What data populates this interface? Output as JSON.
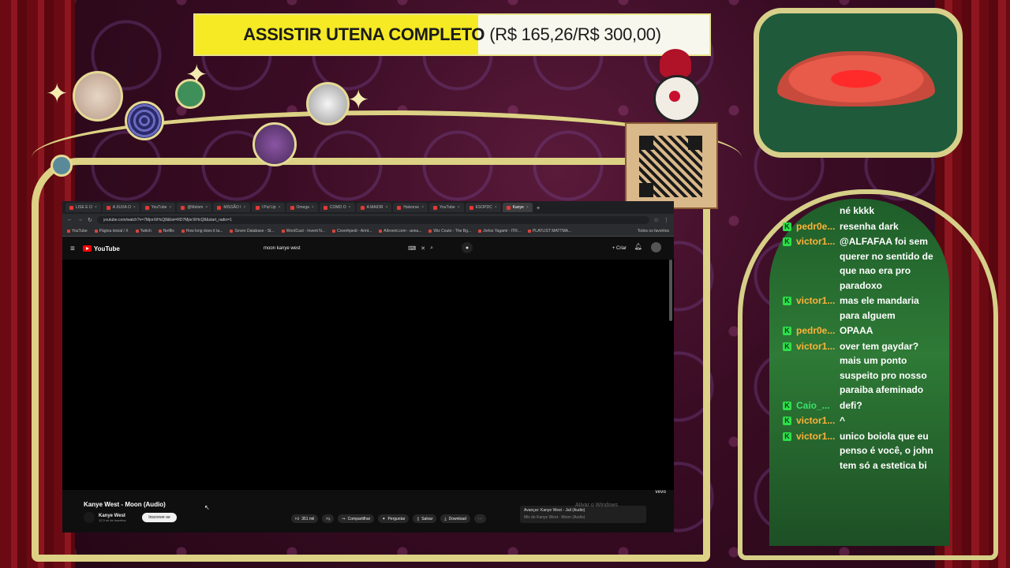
{
  "banner": {
    "label": "ASSISTIR UTENA COMPLETO",
    "value": "(R$ 165,26/R$ 300,00)",
    "progress": 0.551,
    "fill_color": "#f5ea24"
  },
  "browser": {
    "tabs": [
      {
        "label": "LISE E O"
      },
      {
        "label": "A XUXA O"
      },
      {
        "label": "YouTube"
      },
      {
        "label": "@Melom"
      },
      {
        "label": "MISSÃO I"
      },
      {
        "label": "I Put Up"
      },
      {
        "label": "Omega"
      },
      {
        "label": "COMO O"
      },
      {
        "label": "A MAIOR"
      },
      {
        "label": "Halvorse"
      },
      {
        "label": "YouTube"
      },
      {
        "label": "ESOPDC"
      },
      {
        "label": "Kanye"
      }
    ],
    "url": "youtube.com/watch?v=7MjorXiHcQ8&list=RD7MjorXiHcQ8&start_radio=1",
    "bookmarks": [
      "YouTube",
      "Página inicial / X",
      "Twitch",
      "Netflix",
      "How long does it ta...",
      "Seven Database - St...",
      "WordCast - Invent N...",
      "Coverhpedi - Arint...",
      "Allvvent.com - anna...",
      "Wiz Couto - The Bg...",
      "Jorlos Yagami - ITR...",
      "PLAYLIST MATTMA..."
    ],
    "bookmarks_right": "Todos os favoritos"
  },
  "youtube": {
    "logo": "YouTube",
    "search_query": "moon kanye west",
    "create_label": "Criar",
    "video_title": "Kanye West - Moon (Audio)",
    "channel_name": "Kanye West",
    "subscribers": "12,3 mi de inscritos",
    "subscribe_label": "Inscrever-se",
    "likes": "351 mil",
    "share_label": "Compartilhar",
    "ask_label": "Perguntar",
    "save_label": "Salvar",
    "download_label": "Download",
    "upnext_title": "Avançar: Kanye West - Jail (Audio)",
    "upnext_sub": "Mix de Kanye West - Moon (Audio)",
    "vevo": "vevo",
    "windows_notice": "Ativar o Windows"
  },
  "chat": [
    {
      "user": "",
      "color": "",
      "text": "né kkkk",
      "badge": false
    },
    {
      "user": "pedr0e...",
      "color": "#ffb23a",
      "text": "resenha dark",
      "badge": true
    },
    {
      "user": "victor1...",
      "color": "#ffb23a",
      "text": "@ALFAFAA foi sem querer no sentido de que nao era pro paradoxo",
      "badge": true
    },
    {
      "user": "victor1...",
      "color": "#ffb23a",
      "text": "mas ele mandaria para alguem",
      "badge": true
    },
    {
      "user": "pedr0e...",
      "color": "#ffb23a",
      "text": "OPAAA",
      "badge": true
    },
    {
      "user": "victor1...",
      "color": "#ffb23a",
      "text": "over tem gaydar? mais um ponto suspeito pro nosso paraiba afeminado",
      "badge": true
    },
    {
      "user": "Caio_...",
      "color": "#39e36a",
      "text": "defi?",
      "badge": true
    },
    {
      "user": "victor1...",
      "color": "#ffb23a",
      "text": "^",
      "badge": true
    },
    {
      "user": "victor1...",
      "color": "#ffb23a",
      "text": "unico boiola que eu penso é você, o john tem só a estetica bi",
      "badge": true
    }
  ],
  "colors": {
    "frame_gold": "#dcd184",
    "chat_green": "#2e7a36",
    "youtube_red": "#ff0000"
  }
}
